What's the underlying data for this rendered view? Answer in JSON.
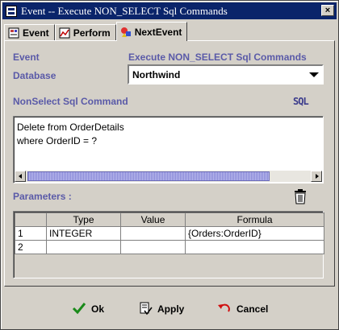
{
  "window": {
    "title": "Event -- Execute NON_SELECT Sql Commands",
    "close_glyph": "×"
  },
  "tabs": [
    {
      "label": "Event",
      "icon": "event-tab-icon",
      "active": false
    },
    {
      "label": "Perform",
      "icon": "chart-icon",
      "active": false
    },
    {
      "label": "NextEvent",
      "icon": "shapes-icon",
      "active": true
    }
  ],
  "form": {
    "event_label": "Event",
    "event_value": "Execute NON_SELECT Sql Commands",
    "database_label": "Database",
    "database_value": "Northwind",
    "command_label": "NonSelect Sql Command",
    "sql_icon_text": "SQL",
    "sql_lines": [
      "Delete from OrderDetails",
      "where OrderID = ?"
    ],
    "parameters_label": "Parameters :"
  },
  "parameters": {
    "columns": [
      "",
      "Type",
      "Value",
      "Formula"
    ],
    "rows": [
      [
        "1",
        "INTEGER",
        "",
        "{Orders:OrderID}"
      ],
      [
        "2",
        "",
        "",
        ""
      ]
    ]
  },
  "buttons": {
    "ok": "Ok",
    "apply": "Apply",
    "cancel": "Cancel"
  },
  "colors": {
    "title_bar": "#0a246a",
    "label": "#5a5aa8",
    "face": "#d4d0c8"
  }
}
